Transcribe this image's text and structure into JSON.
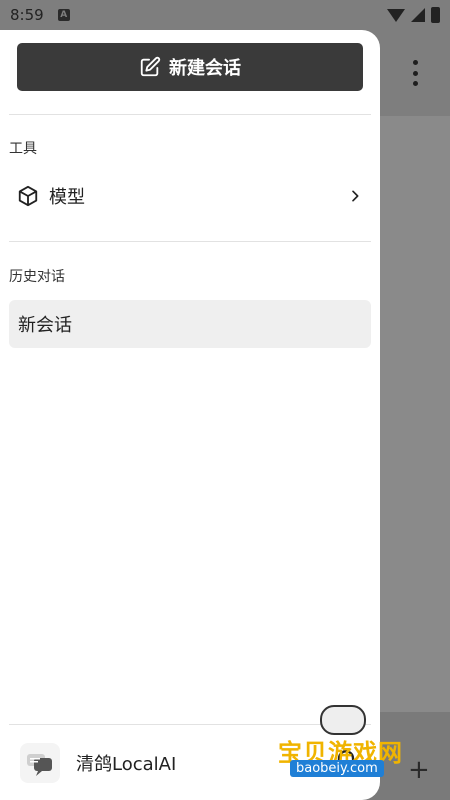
{
  "status_bar": {
    "time": "8:59",
    "notif_letter": "A"
  },
  "drawer": {
    "new_chat_label": "新建会话",
    "tools_section": "工具",
    "model_item": "模型",
    "history_section": "历史对话",
    "history_items": [
      "新会话"
    ],
    "app_name": "清鸽LocalAI"
  },
  "watermark": {
    "title": "宝贝游戏网",
    "url": "baobeiy.com"
  },
  "colors": {
    "button_bg": "#3a3a3a",
    "scrim": "#8a8a8a",
    "selected_item": "#efefef"
  }
}
